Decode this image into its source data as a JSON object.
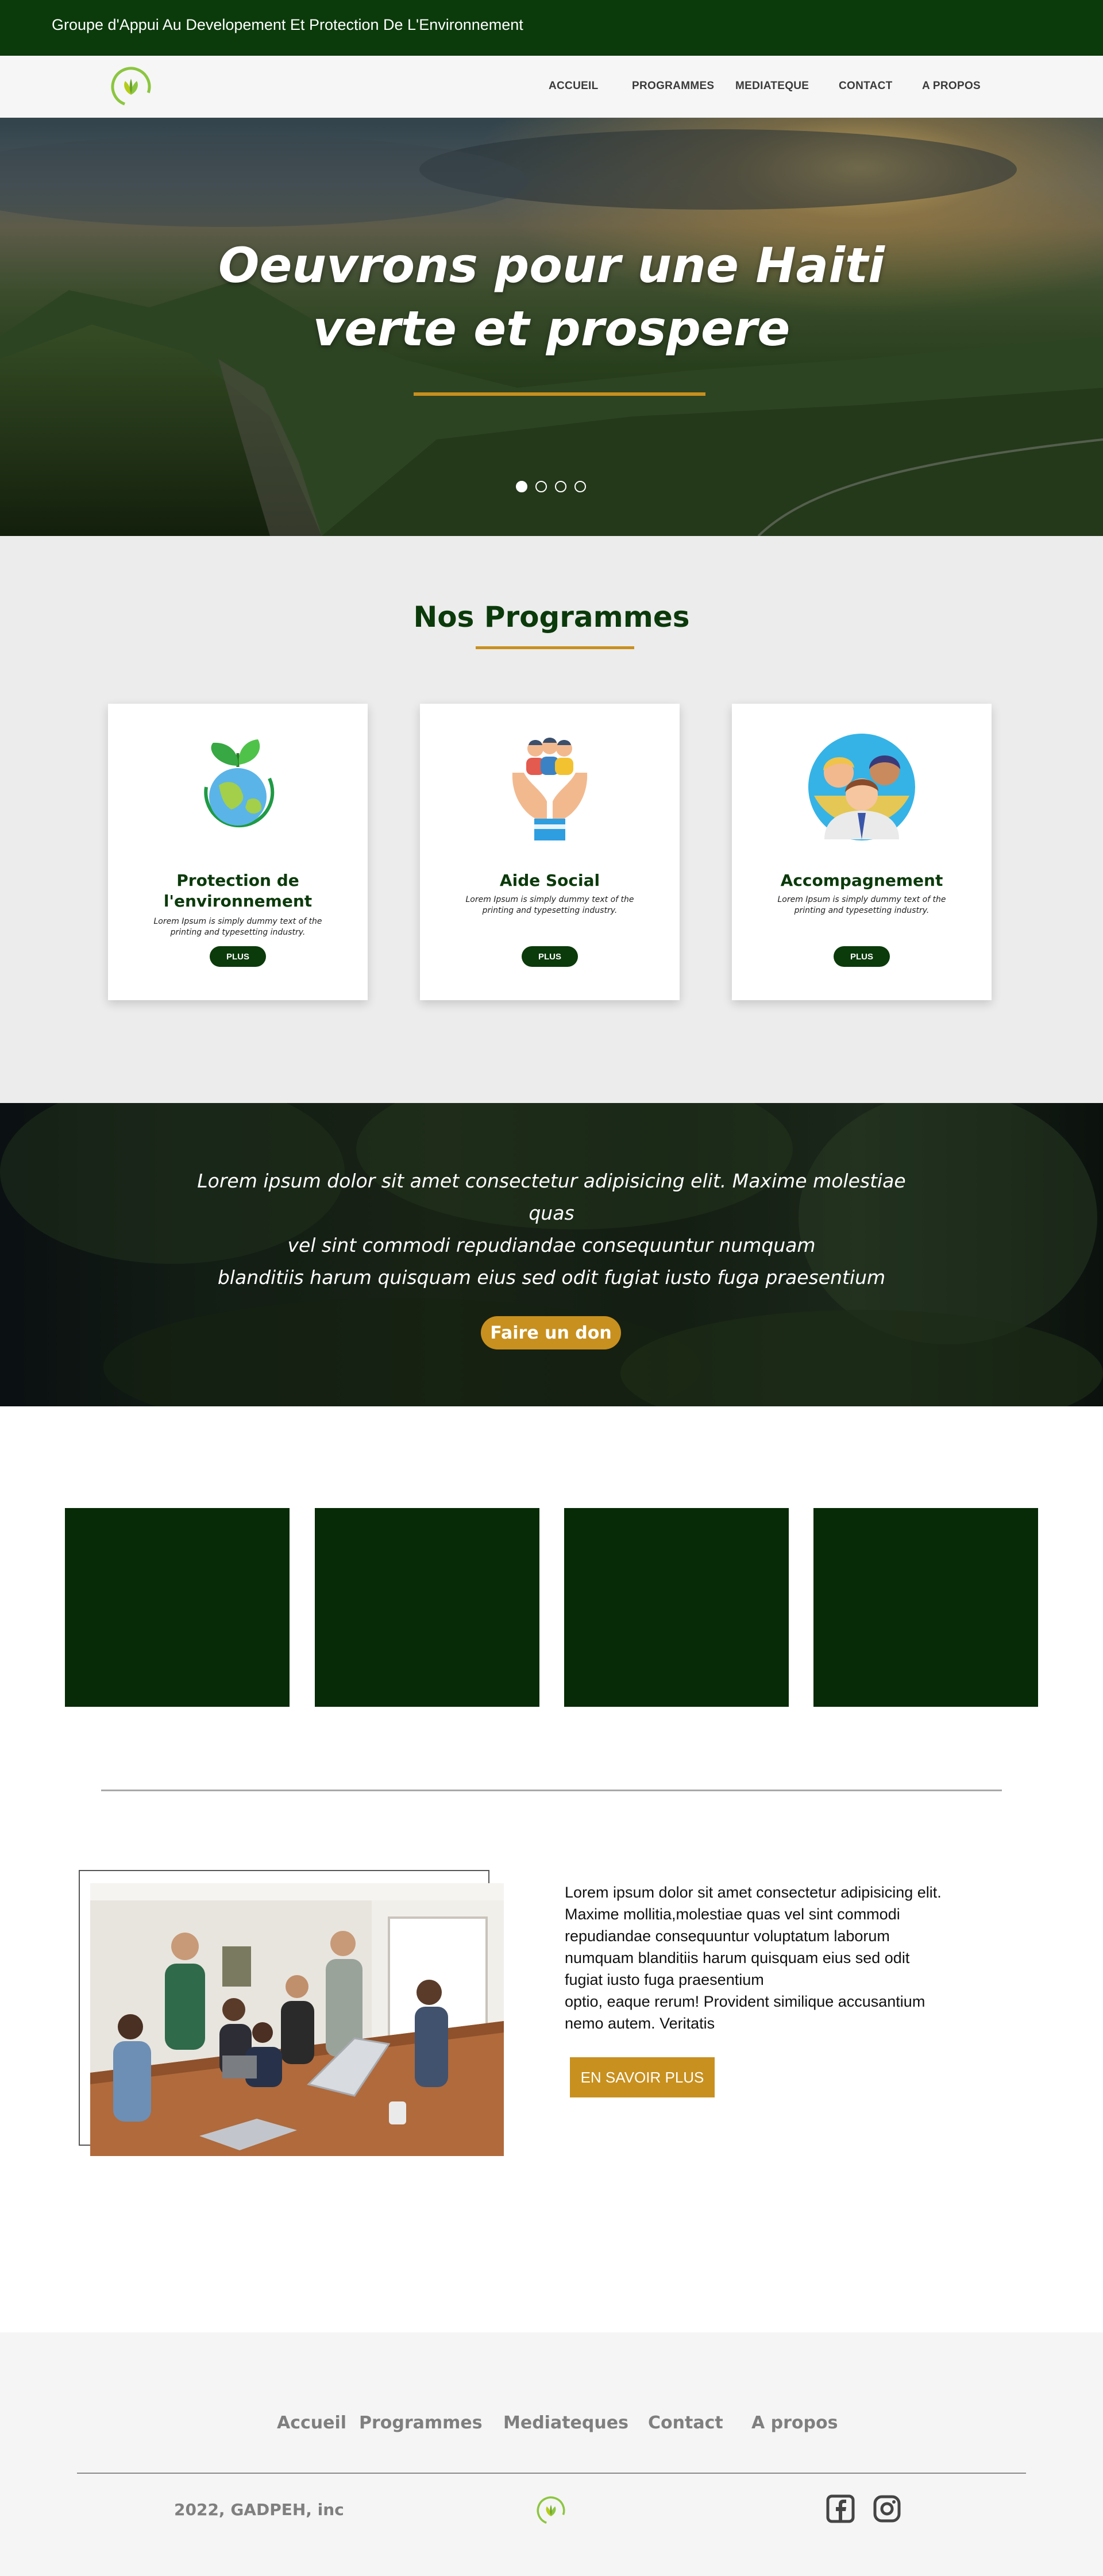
{
  "topbar": {
    "title": "Groupe d'Appui Au Developement Et Protection De L'Environnement"
  },
  "nav": [
    "ACCUEIL",
    "PROGRAMMES",
    "MEDIATEQUE",
    "CONTACT",
    "A PROPOS"
  ],
  "hero": {
    "title_line1": "Oeuvrons pour une Haiti",
    "title_line2": "verte et prospere",
    "slides": 4,
    "active_slide": 1
  },
  "programs": {
    "title": "Nos Programmes",
    "cards": [
      {
        "icon": "earth-leaf-icon",
        "title_line1": "Protection de",
        "title_line2": "l'environnement",
        "desc": "Lorem Ipsum is simply dummy text of the printing and typesetting industry.",
        "button": "PLUS"
      },
      {
        "icon": "hands-people-icon",
        "title_line1": "Aide Social",
        "title_line2": "",
        "desc": "Lorem Ipsum is simply dummy text of the printing and typesetting industry.",
        "button": "PLUS"
      },
      {
        "icon": "people-group-icon",
        "title_line1": "Accompagnement",
        "title_line2": "",
        "desc": "Lorem Ipsum is simply dummy text of the printing and typesetting industry.",
        "button": "PLUS"
      }
    ]
  },
  "donate": {
    "line1": "Lorem ipsum dolor sit amet consectetur adipisicing elit. Maxime molestiae quas",
    "line2": "vel sint commodi repudiandae consequuntur numquam",
    "line3": "blanditiis harum quisquam eius sed odit fugiat iusto fuga praesentium",
    "button": "Faire un don"
  },
  "about": {
    "lines": [
      "Lorem ipsum dolor sit amet consectetur adipisicing elit.",
      "Maxime mollitia,molestiae quas vel sint commodi",
      "repudiandae consequuntur voluptatum laborum",
      "numquam blanditiis harum quisquam eius sed odit",
      "fugiat iusto fuga praesentium",
      "optio, eaque rerum! Provident similique accusantium",
      "nemo autem. Veritatis"
    ],
    "button": "EN SAVOIR PLUS"
  },
  "footer": {
    "links": [
      "Accueil",
      "Programmes",
      "Mediateques",
      "Contact",
      "A propos"
    ],
    "copyright": "2022, GADPEH, inc",
    "social": [
      "facebook-icon",
      "instagram-icon"
    ]
  },
  "colors": {
    "brand_green": "#0b3a0b",
    "accent_gold": "#c8901e",
    "logo_green": "#8cc63f"
  }
}
